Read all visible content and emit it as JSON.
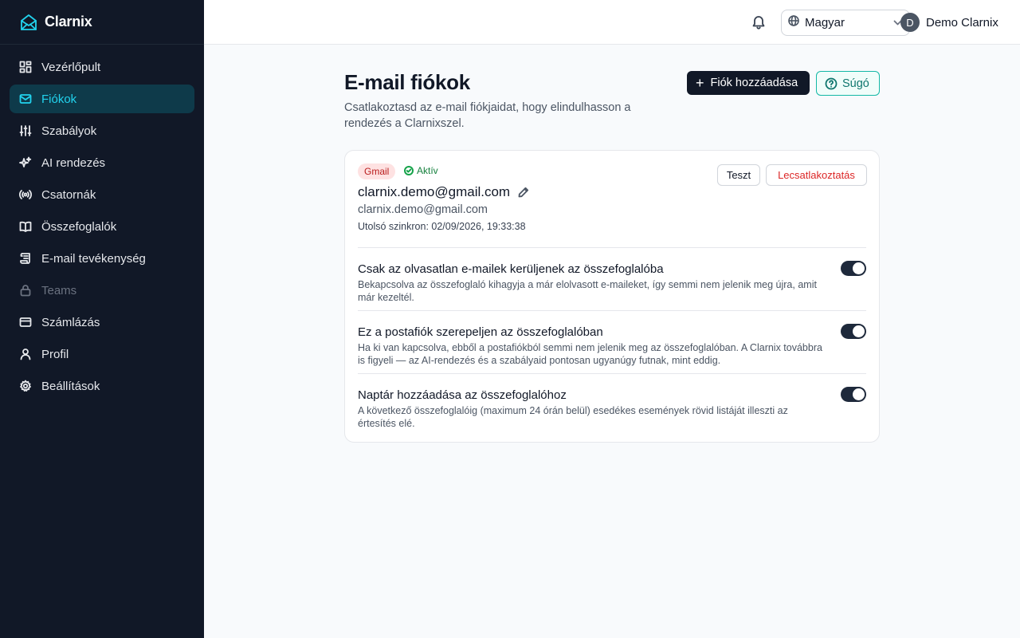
{
  "app": {
    "name": "Clarnix"
  },
  "sidebar": {
    "items": [
      {
        "label": "Vezérlőpult",
        "icon": "dashboard-icon"
      },
      {
        "label": "Fiókok",
        "icon": "mail-icon"
      },
      {
        "label": "Szabályok",
        "icon": "sliders-icon"
      },
      {
        "label": "AI rendezés",
        "icon": "sparkles-icon"
      },
      {
        "label": "Csatornák",
        "icon": "broadcast-icon"
      },
      {
        "label": "Összefoglalók",
        "icon": "book-icon"
      },
      {
        "label": "E-mail tevékenység",
        "icon": "scroll-icon"
      },
      {
        "label": "Teams",
        "icon": "lock-icon"
      },
      {
        "label": "Számlázás",
        "icon": "credit-card-icon"
      },
      {
        "label": "Profil",
        "icon": "user-icon"
      },
      {
        "label": "Beállítások",
        "icon": "gear-icon"
      }
    ],
    "active_index": 1,
    "disabled_index": 7
  },
  "topbar": {
    "language": "Magyar",
    "user_initial": "D",
    "user_name": "Demo Clarnix"
  },
  "page": {
    "title": "E-mail fiókok",
    "subtitle": "Csatlakoztasd az e-mail fiókjaidat, hogy elindulhasson a rendezés a Clarnixszel.",
    "add_button": "Fiók hozzáadása",
    "help_button": "Súgó"
  },
  "account": {
    "provider": "Gmail",
    "status": "Aktív",
    "display_name": "clarnix.demo@gmail.com",
    "email": "clarnix.demo@gmail.com",
    "last_sync": "Utolsó szinkron: 02/09/2026, 19:33:38",
    "test_button": "Teszt",
    "disconnect_button": "Lecsatlakoztatás",
    "settings": [
      {
        "title": "Csak az olvasatlan e-mailek kerüljenek az összefoglalóba",
        "description": "Bekapcsolva az összefoglaló kihagyja a már elolvasott e-maileket, így semmi nem jelenik meg újra, amit már kezeltél.",
        "enabled": true
      },
      {
        "title": "Ez a postafiók szerepeljen az összefoglalóban",
        "description": "Ha ki van kapcsolva, ebből a postafiókból semmi nem jelenik meg az összefoglalóban. A Clarnix továbbra is figyeli — az AI-rendezés és a szabályaid pontosan ugyanúgy futnak, mint eddig.",
        "enabled": true
      },
      {
        "title": "Naptár hozzáadása az összefoglalóhoz",
        "description": "A következő összefoglalóig (maximum 24 órán belül) esedékes események rövid listáját illeszti az értesítés elé.",
        "enabled": true
      }
    ]
  },
  "colors": {
    "sidebar_bg": "#111827",
    "active_accent": "#22d3ee",
    "primary_button": "#111827",
    "help_accent": "#14b8a6",
    "danger": "#dc2626",
    "success": "#16a34a"
  }
}
